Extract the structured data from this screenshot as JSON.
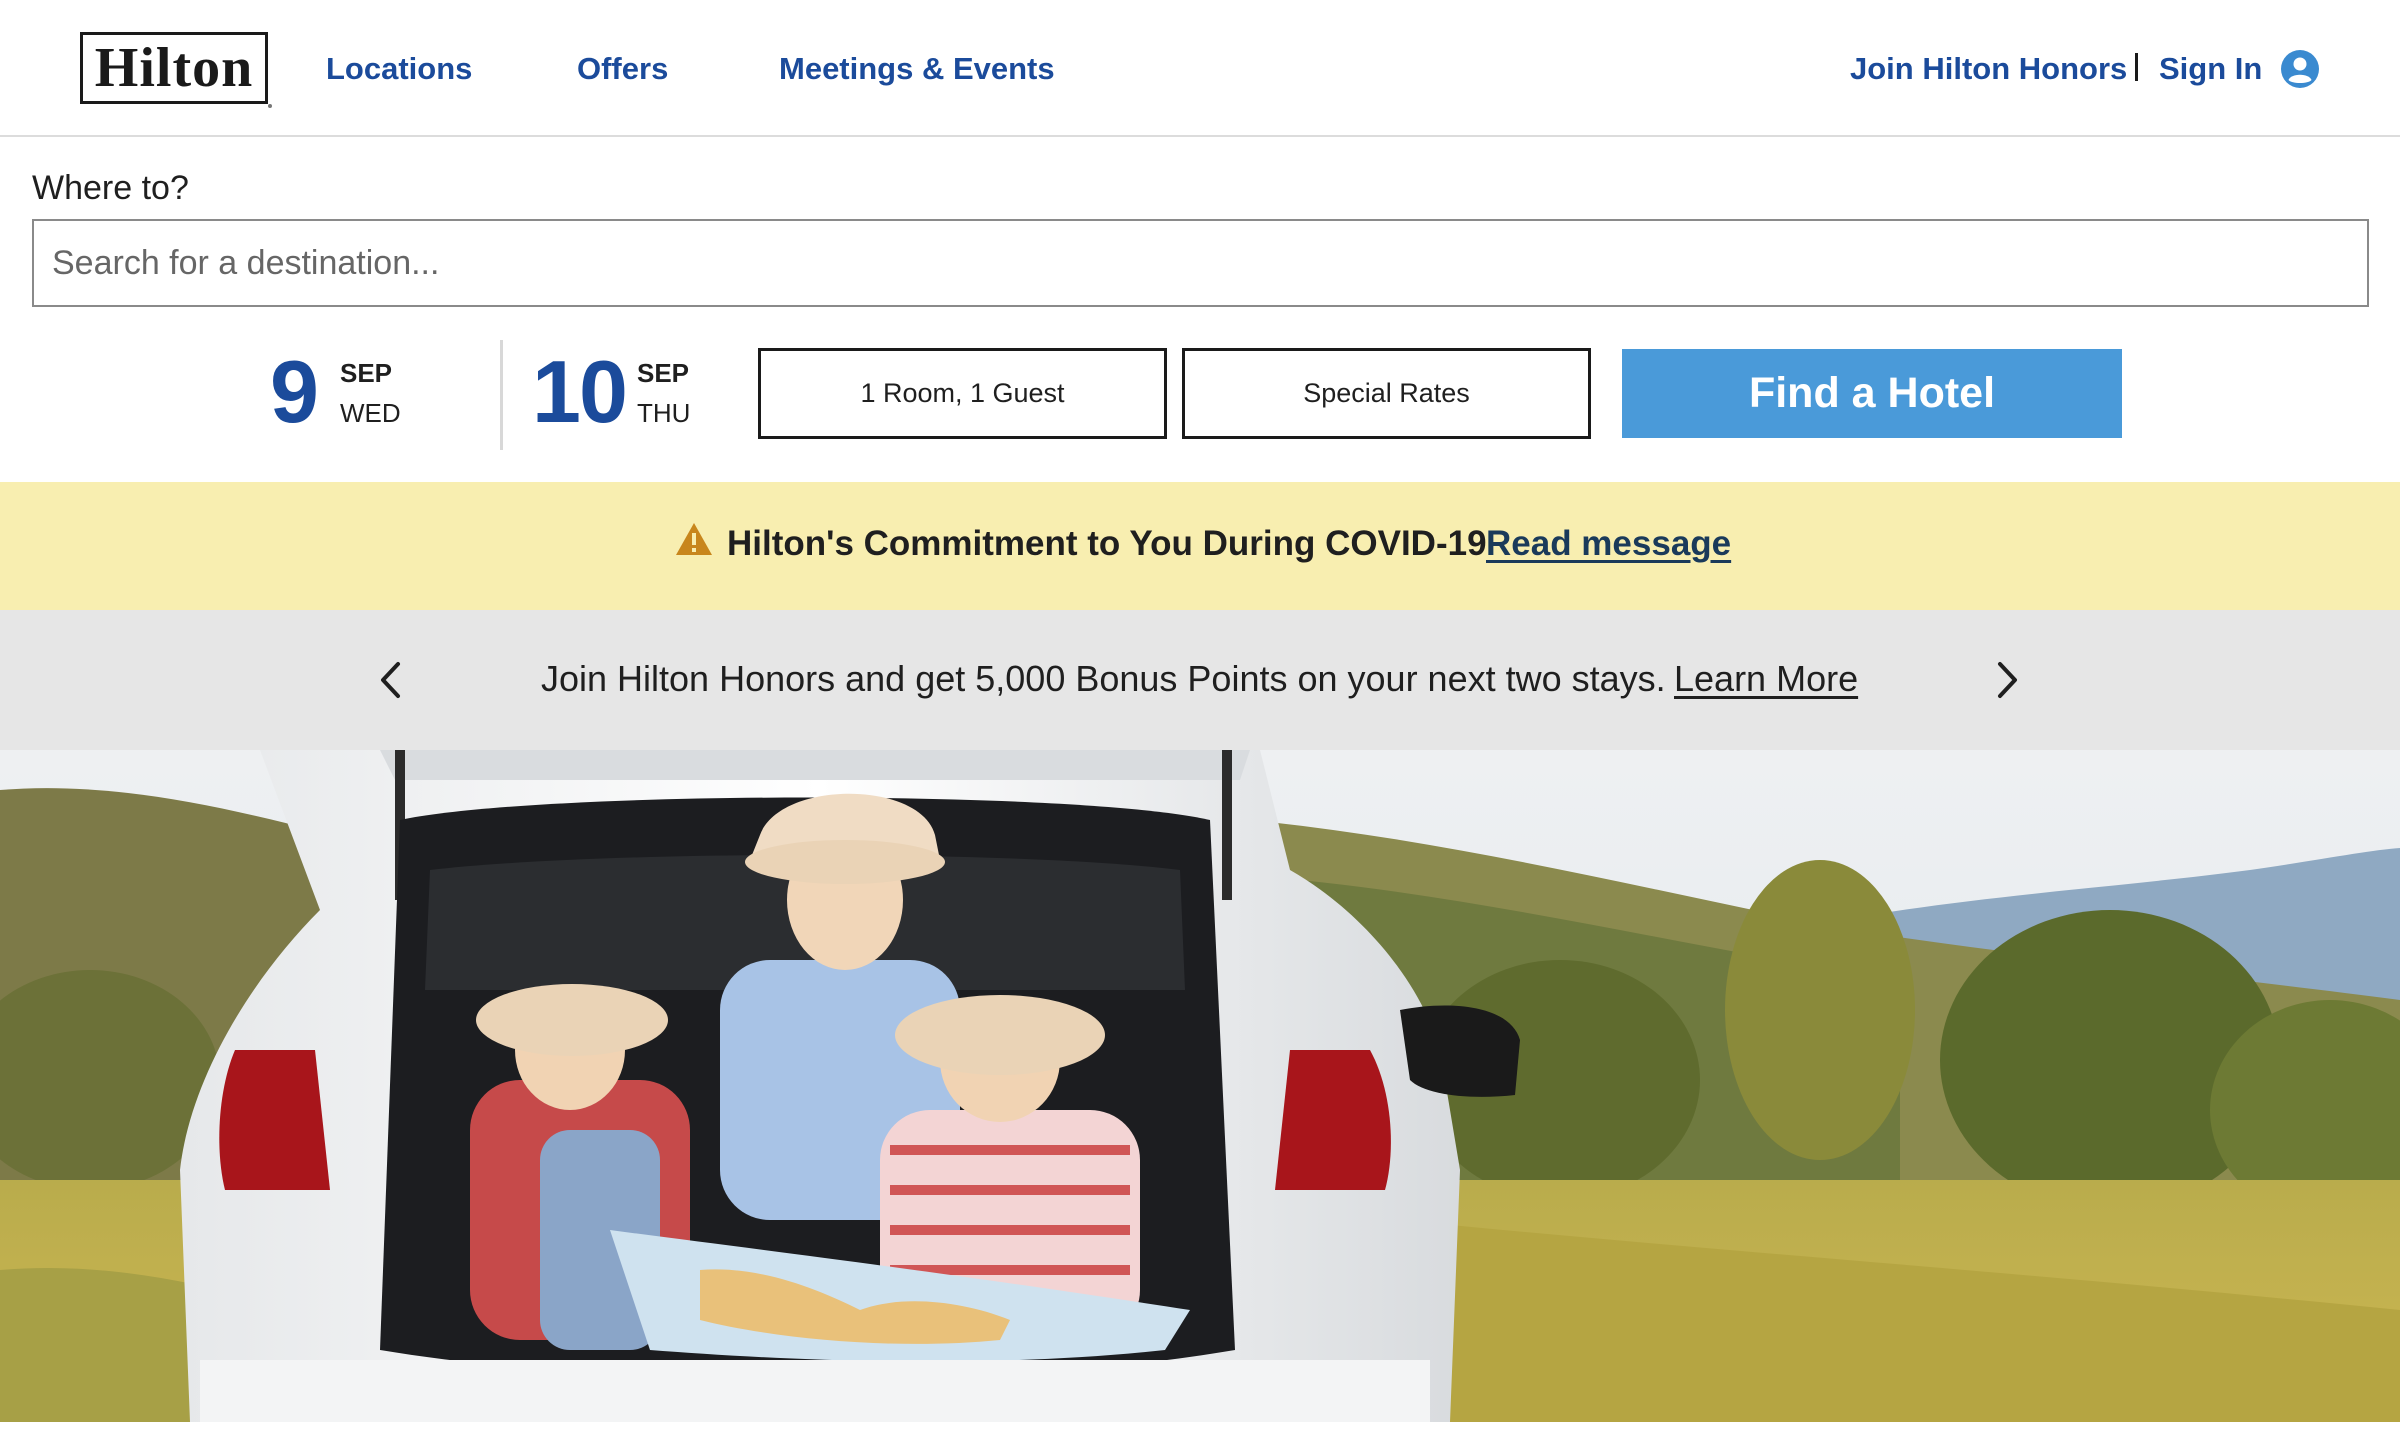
{
  "header": {
    "logo_text": "Hilton",
    "nav": {
      "locations": "Locations",
      "offers": "Offers",
      "meetings": "Meetings & Events",
      "join": "Join Hilton Honors",
      "divider": "|",
      "sign_in": "Sign In"
    },
    "user_icon": "user-circle-icon"
  },
  "search": {
    "label": "Where to?",
    "placeholder": "Search for a destination...",
    "value": ""
  },
  "dates": {
    "check_in": {
      "day": "9",
      "month": "SEP",
      "weekday": "WED"
    },
    "check_out": {
      "day": "10",
      "month": "SEP",
      "weekday": "THU"
    }
  },
  "buttons": {
    "rooms_guests": "1 Room, 1 Guest",
    "special_rates": "Special Rates",
    "find_hotel": "Find a Hotel"
  },
  "covid_banner": {
    "icon": "warning-triangle-icon",
    "text": "Hilton's Commitment to You During COVID-19",
    "link": "Read message"
  },
  "promo": {
    "text": "Join Hilton Honors and get 5,000 Bonus Points on your next two stays.",
    "link": "Learn More",
    "prev_icon": "chevron-left-icon",
    "next_icon": "chevron-right-icon"
  },
  "hero": {
    "alt": "hero-photo-family-reading-map-in-car-trunk"
  },
  "colors": {
    "brand_blue": "#1b4b9b",
    "button_blue": "#4a9ad9",
    "banner_yellow": "#f8eeb0",
    "promo_gray": "#e6e6e6",
    "warning_orange": "#c8861c"
  }
}
